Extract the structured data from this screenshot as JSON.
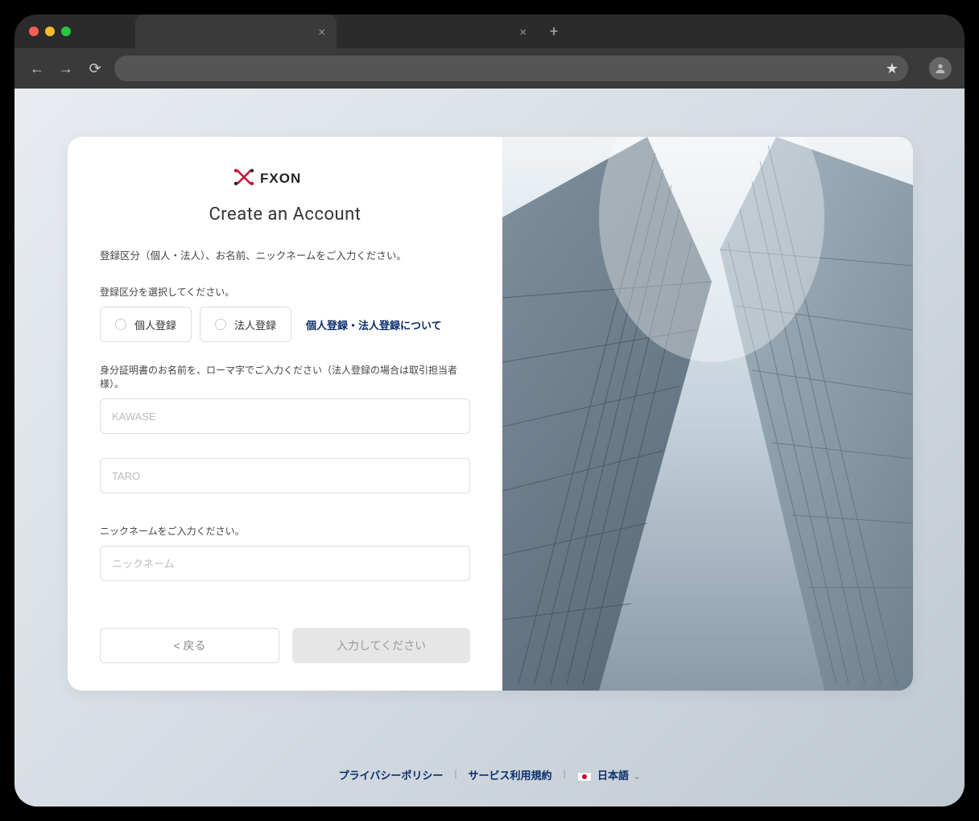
{
  "browser": {
    "tabs": [
      {
        "title": "",
        "active": true
      },
      {
        "title": "",
        "active": false
      }
    ]
  },
  "brand": {
    "name": "FXON"
  },
  "page": {
    "title": "Create an Account",
    "instruction": "登録区分（個人・法人）、お名前、ニックネームをご入力ください。"
  },
  "registration_type": {
    "label": "登録区分を選択してください。",
    "options": {
      "individual": "個人登録",
      "corporate": "法人登録"
    },
    "info_link": "個人登録・法人登録について"
  },
  "name_section": {
    "label": "身分証明書のお名前を、ローマ字でご入力ください（法人登録の場合は取引担当者様）。",
    "lastname_placeholder": "KAWASE",
    "firstname_placeholder": "TARO"
  },
  "nickname_section": {
    "label": "ニックネームをご入力ください。",
    "placeholder": "ニックネーム"
  },
  "buttons": {
    "back": "< 戻る",
    "submit": "入力してください"
  },
  "footer": {
    "privacy": "プライバシーポリシー",
    "terms": "サービス利用規約",
    "language": "日本語"
  }
}
